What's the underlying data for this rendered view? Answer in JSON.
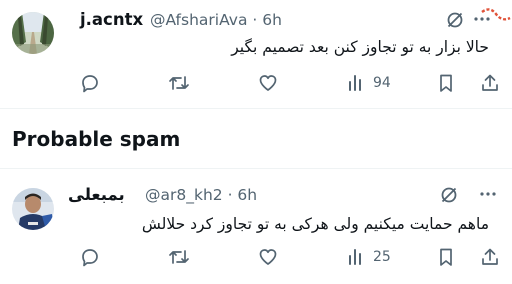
{
  "tweets": [
    {
      "author_name": "j.acntx",
      "handle_time": "@AfshariAva · 6h",
      "text": "حالا بزار به تو تجاوز کنن بعد تصمیم بگیر",
      "views": "94",
      "avatar": "tree-lined-path-photo",
      "actions": [
        "reply-icon",
        "repost-icon",
        "like-icon",
        "views-icon",
        "bookmark-icon",
        "share-icon"
      ]
    },
    {
      "author_name": "بمبعلی",
      "handle_time": "@ar8_kh2 · 6h",
      "text": "ماهم حمایت میکنیم ولی هرکی به تو تجاوز کرد حلالش",
      "views": "25",
      "avatar": "person-photo",
      "actions": [
        "reply-icon",
        "repost-icon",
        "like-icon",
        "views-icon",
        "bookmark-icon",
        "share-icon"
      ]
    }
  ],
  "section": {
    "title": "Probable spam"
  },
  "colors": {
    "text": "#0f1419",
    "secondary": "#536471",
    "divider": "#eff3f4",
    "mark": "#e0533a"
  }
}
